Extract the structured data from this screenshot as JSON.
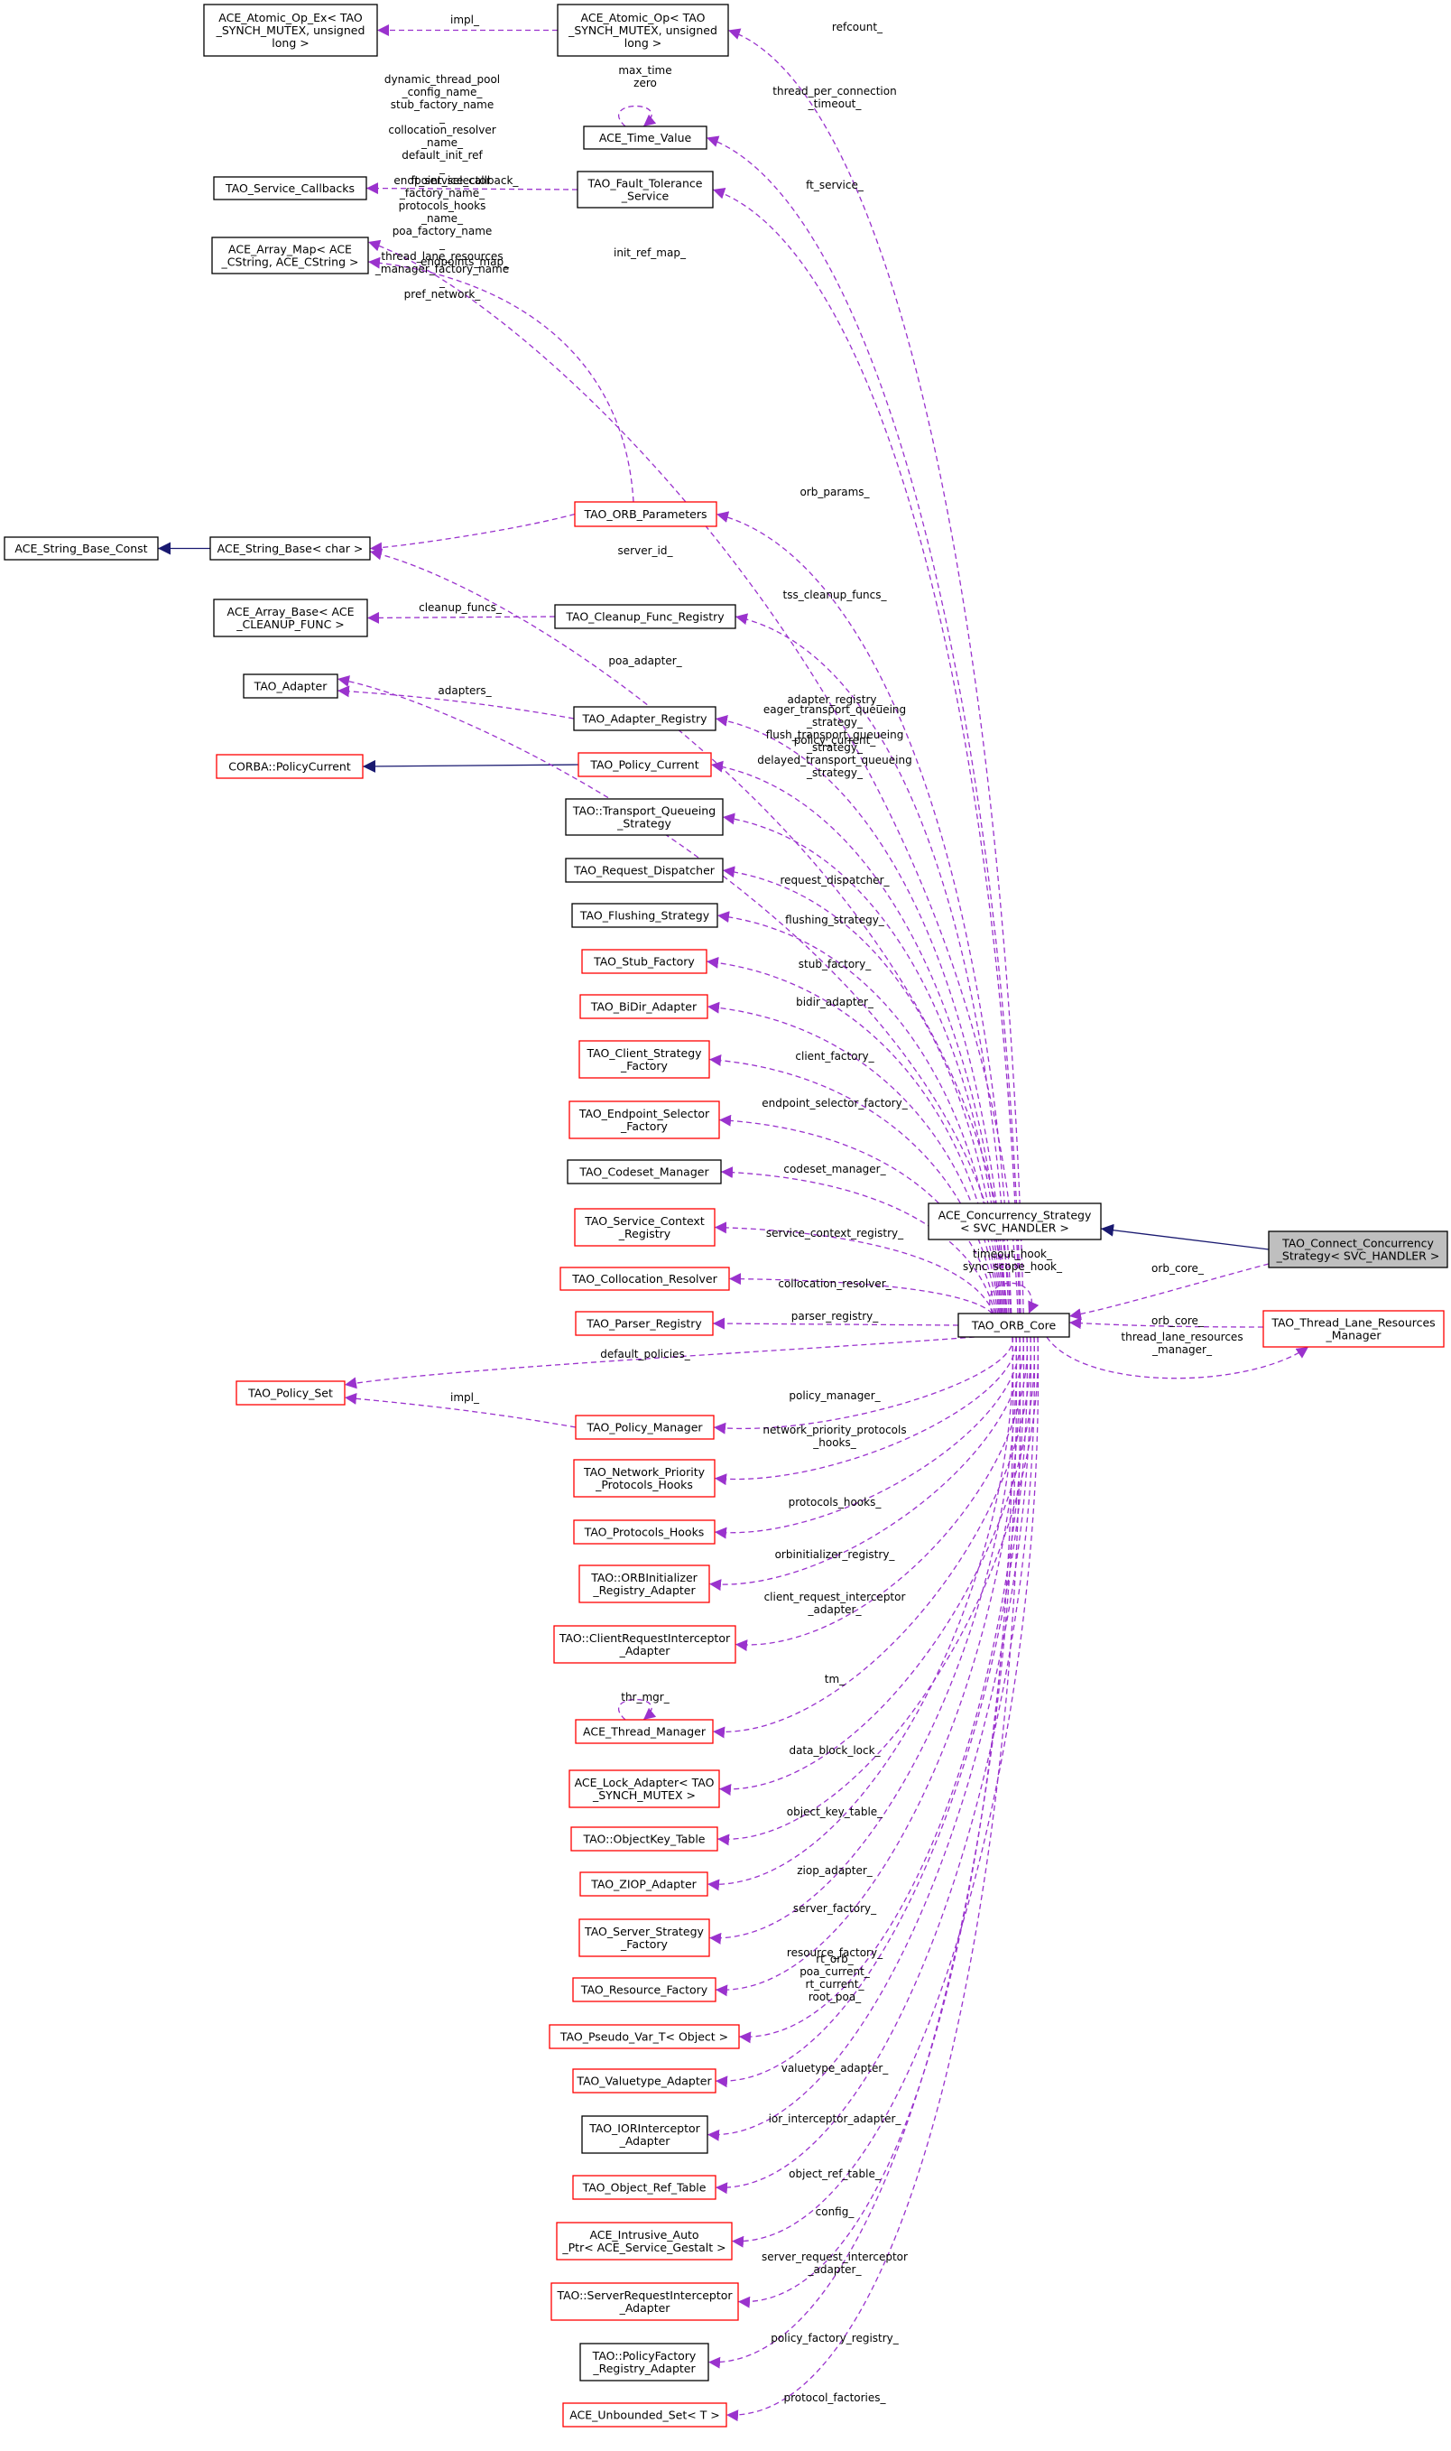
{
  "nodes": {
    "atomic_op_ex": {
      "lines": [
        "ACE_Atomic_Op_Ex< TAO",
        "_SYNCH_MUTEX, unsigned",
        "long >"
      ],
      "style": "plain"
    },
    "atomic_op": {
      "lines": [
        "ACE_Atomic_Op< TAO",
        "_SYNCH_MUTEX, unsigned",
        "long >"
      ],
      "style": "plain"
    },
    "time_value": {
      "lines": [
        "ACE_Time_Value"
      ],
      "style": "plain"
    },
    "service_callbacks": {
      "lines": [
        "TAO_Service_Callbacks"
      ],
      "style": "plain"
    },
    "fault_tolerance": {
      "lines": [
        "TAO_Fault_Tolerance",
        "_Service"
      ],
      "style": "plain"
    },
    "array_map": {
      "lines": [
        "ACE_Array_Map< ACE",
        "_CString, ACE_CString >"
      ],
      "style": "plain"
    },
    "orb_parameters": {
      "lines": [
        "TAO_ORB_Parameters"
      ],
      "style": "red"
    },
    "string_base_const": {
      "lines": [
        "ACE_String_Base_Const"
      ],
      "style": "plain"
    },
    "string_base": {
      "lines": [
        "ACE_String_Base< char >"
      ],
      "style": "plain"
    },
    "array_base": {
      "lines": [
        "ACE_Array_Base< ACE",
        "_CLEANUP_FUNC >"
      ],
      "style": "plain"
    },
    "cleanup_func_registry": {
      "lines": [
        "TAO_Cleanup_Func_Registry"
      ],
      "style": "plain"
    },
    "adapter": {
      "lines": [
        "TAO_Adapter"
      ],
      "style": "plain"
    },
    "adapter_registry": {
      "lines": [
        "TAO_Adapter_Registry"
      ],
      "style": "plain"
    },
    "corba_policycurrent": {
      "lines": [
        "CORBA::PolicyCurrent"
      ],
      "style": "red"
    },
    "policy_current": {
      "lines": [
        "TAO_Policy_Current"
      ],
      "style": "red"
    },
    "transport_queueing": {
      "lines": [
        "TAO::Transport_Queueing",
        "_Strategy"
      ],
      "style": "plain"
    },
    "request_dispatcher": {
      "lines": [
        "TAO_Request_Dispatcher"
      ],
      "style": "plain"
    },
    "flushing_strategy": {
      "lines": [
        "TAO_Flushing_Strategy"
      ],
      "style": "plain"
    },
    "stub_factory": {
      "lines": [
        "TAO_Stub_Factory"
      ],
      "style": "red"
    },
    "bidir_adapter": {
      "lines": [
        "TAO_BiDir_Adapter"
      ],
      "style": "red"
    },
    "client_strategy_factory": {
      "lines": [
        "TAO_Client_Strategy",
        "_Factory"
      ],
      "style": "red"
    },
    "endpoint_selector_factory": {
      "lines": [
        "TAO_Endpoint_Selector",
        "_Factory"
      ],
      "style": "red"
    },
    "codeset_manager": {
      "lines": [
        "TAO_Codeset_Manager"
      ],
      "style": "plain"
    },
    "service_context_registry": {
      "lines": [
        "TAO_Service_Context",
        "_Registry"
      ],
      "style": "red"
    },
    "collocation_resolver": {
      "lines": [
        "TAO_Collocation_Resolver"
      ],
      "style": "red"
    },
    "parser_registry": {
      "lines": [
        "TAO_Parser_Registry"
      ],
      "style": "red"
    },
    "policy_set": {
      "lines": [
        "TAO_Policy_Set"
      ],
      "style": "red"
    },
    "policy_manager": {
      "lines": [
        "TAO_Policy_Manager"
      ],
      "style": "red"
    },
    "network_priority": {
      "lines": [
        "TAO_Network_Priority",
        "_Protocols_Hooks"
      ],
      "style": "red"
    },
    "protocols_hooks": {
      "lines": [
        "TAO_Protocols_Hooks"
      ],
      "style": "red"
    },
    "orbinitializer_registry": {
      "lines": [
        "TAO::ORBInitializer",
        "_Registry_Adapter"
      ],
      "style": "red"
    },
    "client_request_interceptor": {
      "lines": [
        "TAO::ClientRequestInterceptor",
        "_Adapter"
      ],
      "style": "red"
    },
    "thread_manager": {
      "lines": [
        "ACE_Thread_Manager"
      ],
      "style": "red"
    },
    "lock_adapter": {
      "lines": [
        "ACE_Lock_Adapter< TAO",
        "_SYNCH_MUTEX >"
      ],
      "style": "red"
    },
    "objectkey_table": {
      "lines": [
        "TAO::ObjectKey_Table"
      ],
      "style": "red"
    },
    "ziop_adapter": {
      "lines": [
        "TAO_ZIOP_Adapter"
      ],
      "style": "red"
    },
    "server_strategy_factory": {
      "lines": [
        "TAO_Server_Strategy",
        "_Factory"
      ],
      "style": "red"
    },
    "resource_factory": {
      "lines": [
        "TAO_Resource_Factory"
      ],
      "style": "red"
    },
    "pseudo_var": {
      "lines": [
        "TAO_Pseudo_Var_T< Object >"
      ],
      "style": "red"
    },
    "valuetype_adapter": {
      "lines": [
        "TAO_Valuetype_Adapter"
      ],
      "style": "red"
    },
    "iorinterceptor_adapter": {
      "lines": [
        "TAO_IORInterceptor",
        "_Adapter"
      ],
      "style": "plain"
    },
    "object_ref_table": {
      "lines": [
        "TAO_Object_Ref_Table"
      ],
      "style": "red"
    },
    "intrusive_auto_ptr": {
      "lines": [
        "ACE_Intrusive_Auto",
        "_Ptr< ACE_Service_Gestalt >"
      ],
      "style": "red"
    },
    "server_request_interceptor": {
      "lines": [
        "TAO::ServerRequestInterceptor",
        "_Adapter"
      ],
      "style": "red"
    },
    "policyfactory_registry": {
      "lines": [
        "TAO::PolicyFactory",
        "_Registry_Adapter"
      ],
      "style": "plain"
    },
    "unbounded_set": {
      "lines": [
        "ACE_Unbounded_Set< T >"
      ],
      "style": "red"
    },
    "concurrency_strategy": {
      "lines": [
        "ACE_Concurrency_Strategy",
        "< SVC_HANDLER >"
      ],
      "style": "plain"
    },
    "connect_concurrency": {
      "lines": [
        "TAO_Connect_Concurrency",
        "_Strategy< SVC_HANDLER >"
      ],
      "style": "gray"
    },
    "orb_core": {
      "lines": [
        "TAO_ORB_Core"
      ],
      "style": "plain"
    },
    "thread_lane_resources": {
      "lines": [
        "TAO_Thread_Lane_Resources",
        "_Manager"
      ],
      "style": "red"
    }
  },
  "edge_labels": {
    "impl1": [
      "impl_"
    ],
    "refcount": [
      "refcount_"
    ],
    "max_time": [
      "max_time",
      "zero"
    ],
    "thread_per_connection": [
      "thread_per_connection",
      "_timeout_"
    ],
    "ft_service_callback": [
      "ft_service_callback_"
    ],
    "ft_service": [
      "ft_service_"
    ],
    "init_ref_map": [
      "init_ref_map_"
    ],
    "endpoints_map": [
      "endpoints_map_"
    ],
    "string_names": [
      "dynamic_thread_pool",
      "_config_name_",
      "stub_factory_name",
      "_",
      "collocation_resolver",
      "_name_",
      "default_init_ref",
      "_",
      "endpoint_selector",
      "_factory_name_",
      "protocols_hooks",
      "_name_",
      "poa_factory_name",
      "_",
      "thread_lane_resources",
      "_manager_factory_name",
      "_",
      "pref_network_"
    ],
    "orb_params": [
      "orb_params_"
    ],
    "server_id": [
      "server_id_"
    ],
    "cleanup_funcs": [
      "cleanup_funcs_"
    ],
    "tss_cleanup_funcs": [
      "tss_cleanup_funcs_"
    ],
    "poa_adapter": [
      "poa_adapter_"
    ],
    "adapters": [
      "adapters_"
    ],
    "adapter_registry": [
      "adapter_registry_"
    ],
    "policy_current": [
      "policy_current_"
    ],
    "transport_queueing": [
      "eager_transport_queueing",
      "_strategy_",
      "flush_transport_queueing",
      "_strategy_",
      "delayed_transport_queueing",
      "_strategy_"
    ],
    "request_dispatcher": [
      "request_dispatcher_"
    ],
    "flushing_strategy": [
      "flushing_strategy_"
    ],
    "stub_factory": [
      "stub_factory_"
    ],
    "bidir_adapter": [
      "bidir_adapter_"
    ],
    "client_factory": [
      "client_factory_"
    ],
    "endpoint_selector_factory": [
      "endpoint_selector_factory_"
    ],
    "codeset_manager": [
      "codeset_manager_"
    ],
    "service_context_registry": [
      "service_context_registry_"
    ],
    "collocation_resolver": [
      "collocation_resolver_"
    ],
    "parser_registry": [
      "parser_registry_"
    ],
    "default_policies": [
      "default_policies_"
    ],
    "impl2": [
      "impl_"
    ],
    "policy_manager": [
      "policy_manager_"
    ],
    "network_priority": [
      "network_priority_protocols",
      "_hooks_"
    ],
    "protocols_hooks": [
      "protocols_hooks_"
    ],
    "orbinitializer_registry": [
      "orbinitializer_registry_"
    ],
    "client_request_interceptor": [
      "client_request_interceptor",
      "_adapter_"
    ],
    "thr_mgr": [
      "thr_mgr_"
    ],
    "tm": [
      "tm_"
    ],
    "data_block_lock": [
      "data_block_lock_"
    ],
    "object_key_table": [
      "object_key_table_"
    ],
    "ziop_adapter": [
      "ziop_adapter_"
    ],
    "server_factory": [
      "server_factory_"
    ],
    "resource_factory": [
      "resource_factory_"
    ],
    "pseudo_var": [
      "rt_orb_",
      "poa_current_",
      "rt_current_",
      "root_poa_"
    ],
    "valuetype_adapter": [
      "valuetype_adapter_"
    ],
    "ior_interceptor_adapter": [
      "ior_interceptor_adapter_"
    ],
    "object_ref_table": [
      "object_ref_table_"
    ],
    "config": [
      "config_"
    ],
    "server_request_interceptor": [
      "server_request_interceptor",
      "_adapter_"
    ],
    "policy_factory_registry": [
      "policy_factory_registry_"
    ],
    "protocol_factories": [
      "protocol_factories_"
    ],
    "timeout_hook": [
      "timeout_hook_",
      "sync_scope_hook_"
    ],
    "orb_core1": [
      "orb_core_"
    ],
    "orb_core2": [
      "orb_core_"
    ],
    "thread_lane_manager": [
      "thread_lane_resources",
      "_manager_"
    ]
  },
  "colors": {
    "dependency": "#9a32cd",
    "inheritance": "#191970",
    "red_border": "#ff0000",
    "gray_fill": "#bfbfbf"
  }
}
